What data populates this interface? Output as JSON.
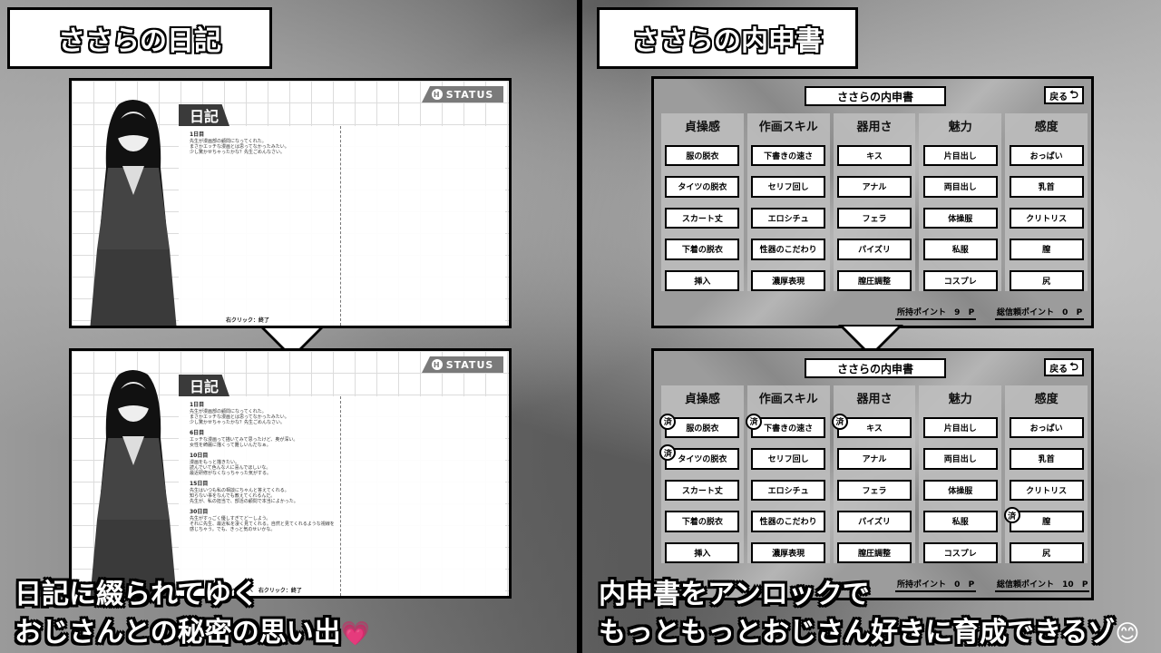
{
  "titles": {
    "left": "ささらの日記",
    "right": "ささらの内申書"
  },
  "diary": {
    "tab": "日記",
    "status": "STATUS",
    "status_icon": "H",
    "footer1": "右クリック：終了",
    "footer2": "のページへ　右クリック：終了",
    "entries_short": [
      {
        "day": "1日目",
        "lines": [
          "先生が漫画部の顧問になってくれた。",
          "まさかエッチな漫画とは思ってなかったみたい。",
          "少し驚かせちゃったかな？先生ごめんなさい。"
        ]
      }
    ],
    "entries_full": [
      {
        "day": "1日目",
        "lines": [
          "先生が漫画部の顧問になってくれた。",
          "まさかエッチな漫画とは思ってなかったみたい。",
          "少し驚かせちゃったかな？先生ごめんなさい。"
        ]
      },
      {
        "day": "6日目",
        "lines": [
          "エッチな漫画って描いてみて思ったけど、奥が深い。",
          "女性を綺麗に描くって難しいんだなぁ。"
        ]
      },
      {
        "day": "10日目",
        "lines": [
          "漫画をもっと描きたい。",
          "読んでいて色んな人に喜んでほしいな。",
          "最近研修がなくなっちゃった気がする。"
        ]
      },
      {
        "day": "15日目",
        "lines": [
          "先生はいつも私の相談にちゃんと答えてくれる。",
          "知らない事をなんでも教えてくれるんだ。",
          "先生が、私の担当で、部活の顧問で本当によかった。"
        ]
      },
      {
        "day": "30日目",
        "lines": [
          "先生がすっごく優しすぎてどーしよう。",
          "それに先生、最近私を凄く見てくれる。自然と見てくれるような視線を",
          "感じちゃう。でも、きっと気のせいかな。"
        ]
      }
    ]
  },
  "report": {
    "title": "ささらの内申書",
    "back": "戻る",
    "back_icon": "return-arrow-icon",
    "stamp": "済",
    "columns": [
      {
        "head": "貞操感",
        "items": [
          "服の脱衣",
          "タイツの脱衣",
          "スカート丈",
          "下着の脱衣",
          "挿入"
        ]
      },
      {
        "head": "作画スキル",
        "items": [
          "下書きの速さ",
          "セリフ回し",
          "エロシチュ",
          "性器のこだわり",
          "濃厚表現"
        ]
      },
      {
        "head": "器用さ",
        "items": [
          "キス",
          "アナル",
          "フェラ",
          "パイズリ",
          "膣圧調整"
        ]
      },
      {
        "head": "魅力",
        "items": [
          "片目出し",
          "両目出し",
          "体操服",
          "私服",
          "コスプレ"
        ]
      },
      {
        "head": "感度",
        "items": [
          "おっぱい",
          "乳首",
          "クリトリス",
          "膣",
          "尻"
        ]
      }
    ],
    "points_label": "所持ポイント",
    "trust_label": "総信頼ポイント",
    "unit": "P",
    "before": {
      "points": "9",
      "trust": "0"
    },
    "after": {
      "points": "0",
      "trust": "10"
    }
  },
  "captions": {
    "left1": "日記に綴られてゆく",
    "left2": "おじさんとの秘密の思い出",
    "left2_emoji": "💗",
    "right1": "内申書をアンロックで",
    "right2": "もっともっとおじさん好きに育成できるゾ",
    "right2_emoji": "😊"
  }
}
